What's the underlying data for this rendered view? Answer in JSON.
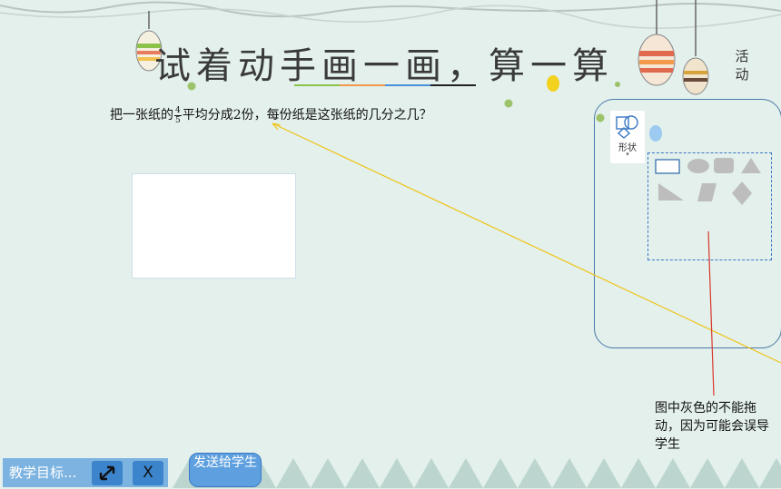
{
  "title": "试着动手画一画，算一算",
  "side_label": "活动",
  "question": {
    "prefix": "把一张纸的",
    "fraction_numerator": "4",
    "fraction_denominator": "5",
    "suffix": "平均分成2份，每份纸是这张纸的几分之几？"
  },
  "toolbar": {
    "shape_label": "形状",
    "shape_caret": "▾"
  },
  "note": "图中灰色的不能拖动，因为可能会误导学生",
  "bottom": {
    "goal_label": "教学目标...",
    "close_label": "X",
    "send_label": "发送给学生"
  },
  "colors": {
    "background": "#e3f0ec",
    "accent_blue": "#3c84cc",
    "shape_gray": "#bdbdbd",
    "underline": [
      "#8cc24a",
      "#f2994a",
      "#4a90d9",
      "#222222"
    ]
  }
}
